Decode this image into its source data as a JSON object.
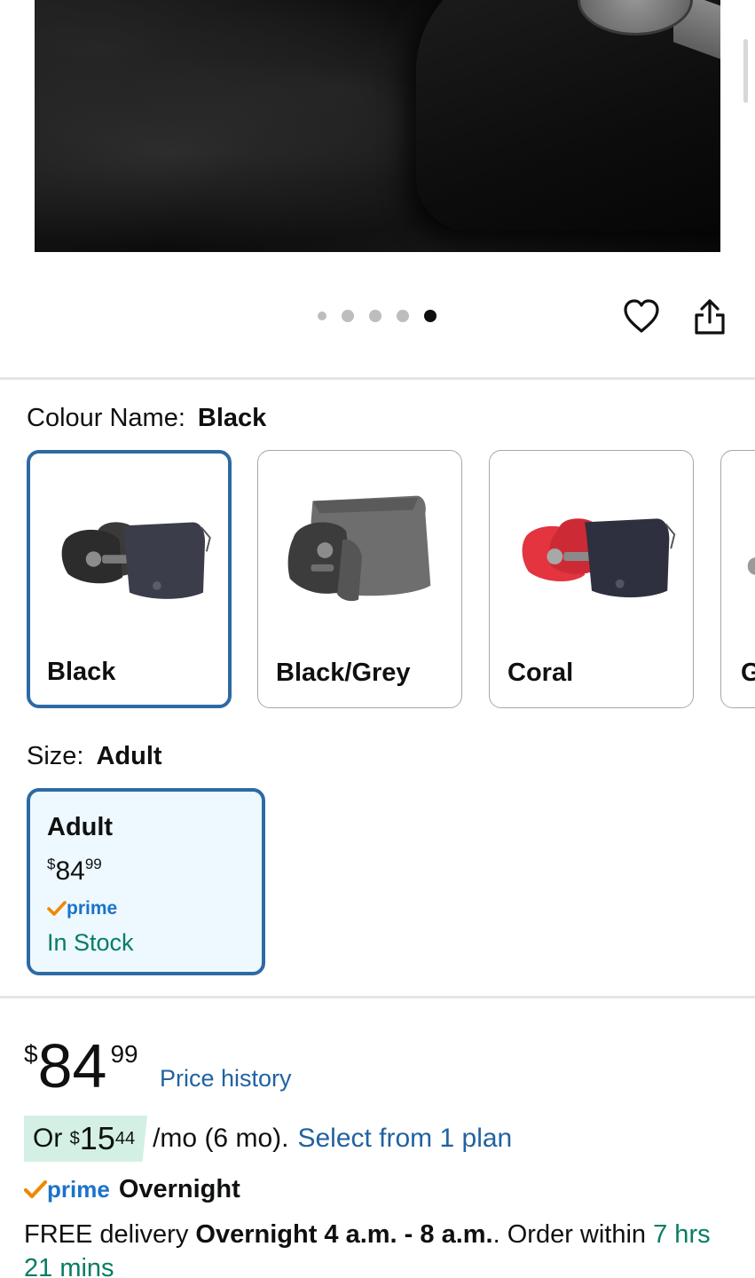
{
  "gallery": {
    "dot_count": 5,
    "active_dot": 5
  },
  "icons": {
    "wishlist": "heart-icon",
    "share": "share-icon"
  },
  "colour": {
    "label": "Colour Name:",
    "selected": "Black",
    "options": [
      {
        "name": "Black",
        "selected": true
      },
      {
        "name": "Black/Grey",
        "selected": false
      },
      {
        "name": "Coral",
        "selected": false
      },
      {
        "name": "G",
        "selected": false
      }
    ]
  },
  "size": {
    "label": "Size:",
    "selected": "Adult",
    "option": {
      "name": "Adult",
      "price_currency": "$",
      "price_whole": "84",
      "price_fraction": "99",
      "prime_label": "prime",
      "stock": "In Stock"
    }
  },
  "price": {
    "currency": "$",
    "whole": "84",
    "fraction": "99",
    "history_link": "Price history"
  },
  "plan": {
    "prefix": "Or",
    "currency": "$",
    "whole": "15",
    "fraction": "44",
    "term": "/mo (6 mo).",
    "link": "Select from 1 plan"
  },
  "shipping": {
    "prime_label": "prime",
    "speed": "Overnight",
    "free_text": "FREE delivery",
    "window": "Overnight 4 a.m. - 8 a.m.",
    "order_within_text": ". Order within",
    "countdown": "7 hrs 21 mins"
  },
  "colors": {
    "link": "#2162a1",
    "selected_border": "#2d6aa3",
    "stock_green": "#067d62",
    "prime_blue": "#1a73c8",
    "prime_check": "#f08804",
    "plan_chip": "#d4f0e4"
  }
}
